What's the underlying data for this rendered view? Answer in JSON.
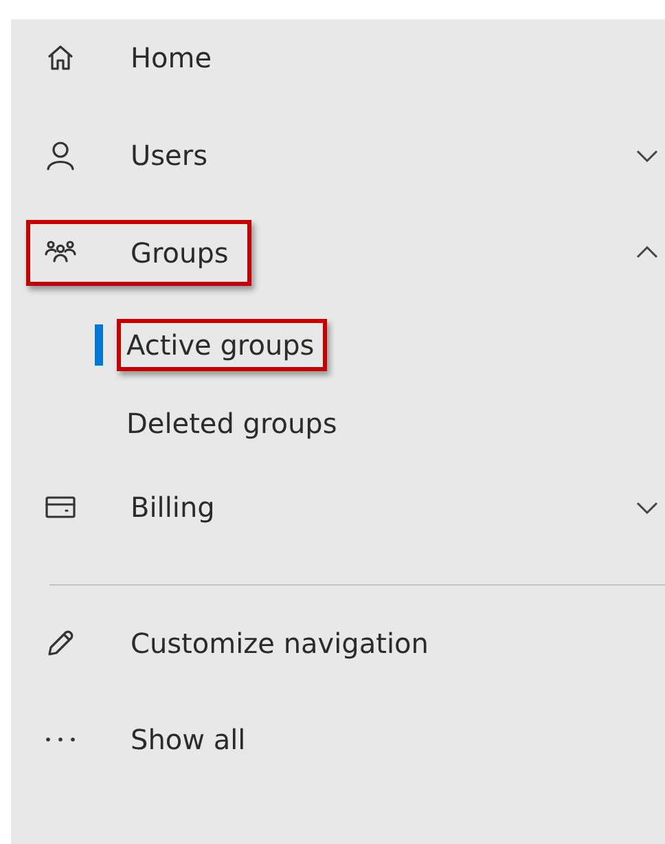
{
  "nav": {
    "items": [
      {
        "kind": "link",
        "label": "Home",
        "highlighted": false
      },
      {
        "kind": "group",
        "label": "Users",
        "expanded": false,
        "highlighted": false
      },
      {
        "kind": "group",
        "label": "Groups",
        "expanded": true,
        "highlighted": true,
        "children": [
          {
            "label": "Active groups",
            "selected": true,
            "highlighted": true
          },
          {
            "label": "Deleted groups",
            "selected": false,
            "highlighted": false
          }
        ]
      },
      {
        "kind": "group",
        "label": "Billing",
        "expanded": false,
        "highlighted": false
      }
    ],
    "footer": [
      {
        "label": "Customize navigation"
      },
      {
        "label": "Show all"
      }
    ]
  }
}
